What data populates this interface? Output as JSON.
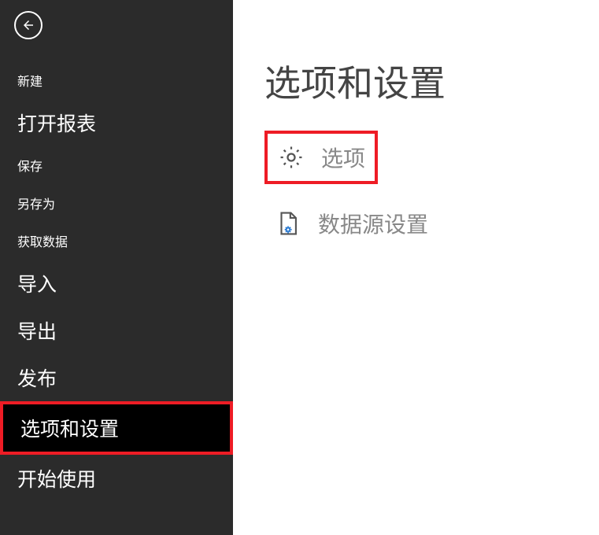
{
  "sidebar": {
    "items": [
      {
        "label": "新建"
      },
      {
        "label": "打开报表"
      },
      {
        "label": "保存"
      },
      {
        "label": "另存为"
      },
      {
        "label": "获取数据"
      },
      {
        "label": "导入"
      },
      {
        "label": "导出"
      },
      {
        "label": "发布"
      },
      {
        "label": "选项和设置"
      },
      {
        "label": "开始使用"
      }
    ]
  },
  "main": {
    "title": "选项和设置",
    "options": [
      {
        "label": "选项"
      },
      {
        "label": "数据源设置"
      }
    ]
  }
}
